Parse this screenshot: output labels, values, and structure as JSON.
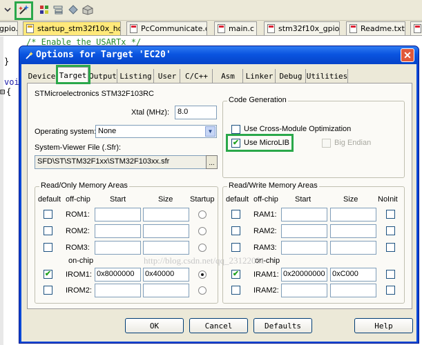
{
  "ide": {
    "file_tabs": [
      "gpio.h",
      "startup_stm32f10x_hd.s",
      "PcCommunicate.c",
      "main.c",
      "stm32f10x_gpio.c",
      "Readme.txt"
    ],
    "code_lines": [
      {
        "text": "/* Enable the USARTx */",
        "kind": "comment"
      },
      {
        "text": "}",
        "kind": "plain"
      },
      {
        "text": "voi",
        "kind": "kw"
      },
      {
        "text": "{",
        "kind": "plain"
      }
    ]
  },
  "dialog": {
    "title": "Options for Target 'EC20'",
    "tabs": [
      "Device",
      "Target",
      "Output",
      "Listing",
      "User",
      "C/C++",
      "Asm",
      "Linker",
      "Debug",
      "Utilities"
    ],
    "active_tab": "Target",
    "device_name": "STMicroelectronics STM32F103RC",
    "xtal_label": "Xtal (MHz):",
    "xtal_value": "8.0",
    "os_label": "Operating system:",
    "os_value": "None",
    "sysviewer_label": "System-Viewer File (.Sfr):",
    "sysviewer_value": "SFD\\ST\\STM32F1xx\\STM32F103xx.sfr",
    "browse_label": "...",
    "codegen": {
      "title": "Code Generation",
      "cross_module_label": "Use Cross-Module Optimization",
      "cross_module_checked": false,
      "microlib_label": "Use MicroLIB",
      "microlib_checked": true,
      "big_endian_label": "Big Endian",
      "big_endian_checked": false
    },
    "ro_memory": {
      "title": "Read/Only Memory Areas",
      "headers": {
        "default": "default",
        "offchip": "off-chip",
        "start": "Start",
        "size": "Size",
        "startup": "Startup"
      },
      "on_chip_label": "on-chip",
      "rows": [
        {
          "name": "ROM1:",
          "default": false,
          "start": "",
          "size": "",
          "startup": false
        },
        {
          "name": "ROM2:",
          "default": false,
          "start": "",
          "size": "",
          "startup": false
        },
        {
          "name": "ROM3:",
          "default": false,
          "start": "",
          "size": "",
          "startup": false
        },
        {
          "name": "IROM1:",
          "default": true,
          "start": "0x8000000",
          "size": "0x40000",
          "startup": true
        },
        {
          "name": "IROM2:",
          "default": false,
          "start": "",
          "size": "",
          "startup": false
        }
      ]
    },
    "rw_memory": {
      "title": "Read/Write Memory Areas",
      "headers": {
        "default": "default",
        "offchip": "off-chip",
        "start": "Start",
        "size": "Size",
        "noinit": "NoInit"
      },
      "on_chip_label": "on-chip",
      "rows": [
        {
          "name": "RAM1:",
          "default": false,
          "start": "",
          "size": "",
          "noinit": false
        },
        {
          "name": "RAM2:",
          "default": false,
          "start": "",
          "size": "",
          "noinit": false
        },
        {
          "name": "RAM3:",
          "default": false,
          "start": "",
          "size": "",
          "noinit": false
        },
        {
          "name": "IRAM1:",
          "default": true,
          "start": "0x20000000",
          "size": "0xC000",
          "noinit": false
        },
        {
          "name": "IRAM2:",
          "default": false,
          "start": "",
          "size": "",
          "noinit": false
        }
      ]
    },
    "watermark": "http://blog.csdn.net/qq_23122031",
    "buttons": {
      "ok": "OK",
      "cancel": "Cancel",
      "defaults": "Defaults",
      "help": "Help"
    }
  },
  "colors": {
    "highlight": "#2aa84a",
    "titlebar": "#0a54e0"
  }
}
